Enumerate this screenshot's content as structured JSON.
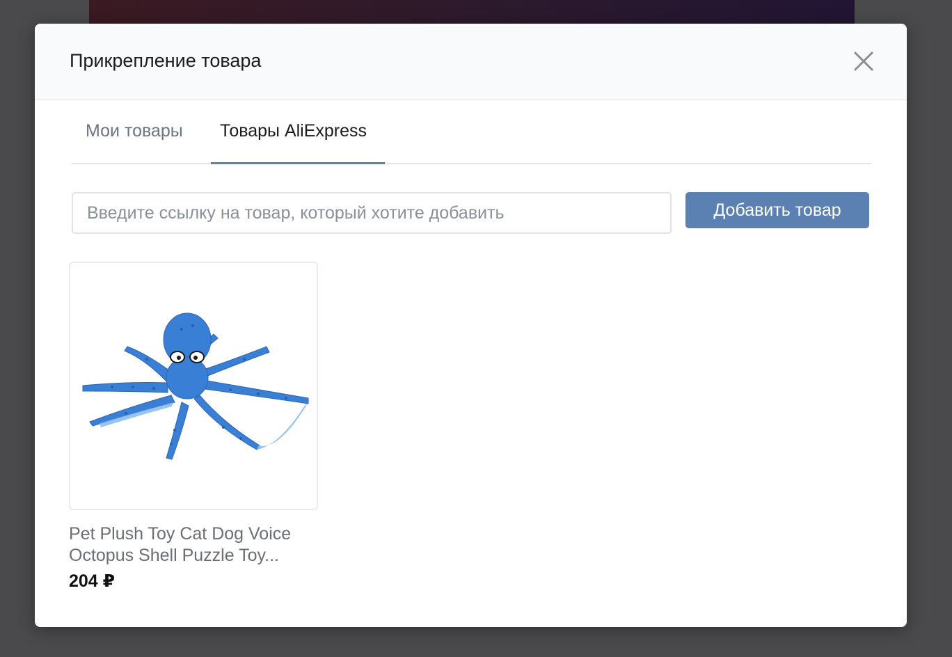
{
  "modal": {
    "title": "Прикрепление товара"
  },
  "tabs": [
    {
      "label": "Мои товары",
      "active": false
    },
    {
      "label": "Товары AliExpress",
      "active": true
    }
  ],
  "search": {
    "value": "",
    "placeholder": "Введите ссылку на товар, который хотите добавить"
  },
  "add_button": {
    "label": "Добавить товар"
  },
  "products": [
    {
      "title_line1": "Pet Plush Toy Cat Dog Voice",
      "title_line2": "Octopus Shell Puzzle Toy...",
      "price": "204 ₽",
      "image": "blue-octopus-plush-toy"
    }
  ],
  "colors": {
    "accent": "#5b80b2",
    "overlay": "#4a4a4d",
    "octopus": "#3a7fd6"
  },
  "icons": {
    "close": "close-icon"
  }
}
